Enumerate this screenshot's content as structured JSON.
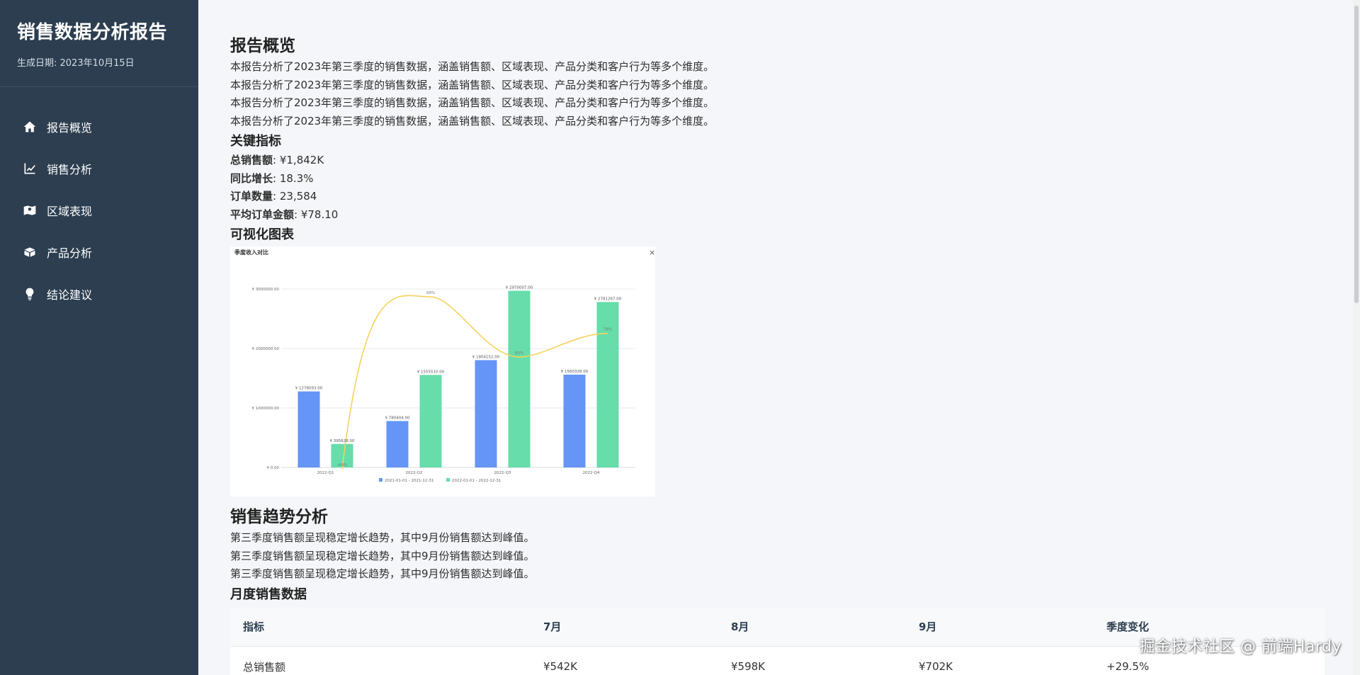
{
  "sidebar": {
    "title": "销售数据分析报告",
    "date": "生成日期: 2023年10月15日",
    "items": [
      {
        "label": "报告概览",
        "icon": "home-icon"
      },
      {
        "label": "销售分析",
        "icon": "line-chart-icon"
      },
      {
        "label": "区域表现",
        "icon": "map-icon"
      },
      {
        "label": "产品分析",
        "icon": "box-icon"
      },
      {
        "label": "结论建议",
        "icon": "lightbulb-icon"
      }
    ]
  },
  "overview": {
    "title": "报告概览",
    "paragraphs": [
      "本报告分析了2023年第三季度的销售数据，涵盖销售额、区域表现、产品分类和客户行为等多个维度。",
      "本报告分析了2023年第三季度的销售数据，涵盖销售额、区域表现、产品分类和客户行为等多个维度。",
      "本报告分析了2023年第三季度的销售数据，涵盖销售额、区域表现、产品分类和客户行为等多个维度。",
      "本报告分析了2023年第三季度的销售数据，涵盖销售额、区域表现、产品分类和客户行为等多个维度。"
    ],
    "metrics_title": "关键指标",
    "metrics": [
      {
        "label": "总销售额",
        "value": ": ¥1,842K"
      },
      {
        "label": "同比增长",
        "value": ": 18.3%"
      },
      {
        "label": "订单数量",
        "value": ": 23,584"
      },
      {
        "label": "平均订单金额",
        "value": ": ¥78.10"
      }
    ],
    "chart_title": "可视化图表"
  },
  "chart_data": {
    "type": "bar",
    "title": "季度收入对比",
    "close_glyph": "×",
    "categories": [
      "2022-Q1",
      "2022-Q2",
      "2022-Q3",
      "2022-Q4"
    ],
    "ylim": [
      0,
      3000000
    ],
    "yticks": [
      "¥ 0.00",
      "¥ 1000000.00",
      "¥ 2000000.00",
      "¥ 3000000.00"
    ],
    "series": [
      {
        "name": "2021-01-01 - 2021-12-31",
        "color": "#6595f7",
        "values": [
          1278093,
          780404,
          1804152,
          1560328
        ],
        "labels": [
          "¥ 1278093.00",
          "¥ 780404.00",
          "¥ 1804152.00",
          "¥ 1560328.00"
        ]
      },
      {
        "name": "2022-01-01 - 2022-12-31",
        "color": "#66ddaa",
        "values": [
          395628,
          1555510,
          2970007,
          2781267
        ],
        "labels": [
          "¥ 395628.00",
          "¥ 1555510.00",
          "¥ 2970007.00",
          "¥ 2781267.00"
        ]
      }
    ],
    "line": {
      "color": "#f7d25c",
      "labels": [
        "-69%",
        "99%",
        "65%",
        "78%"
      ]
    },
    "legend": "bottom",
    "grid": true
  },
  "trend": {
    "title": "销售趋势分析",
    "paragraphs": [
      "第三季度销售额呈现稳定增长趋势，其中9月份销售额达到峰值。",
      "第三季度销售额呈现稳定增长趋势，其中9月份销售额达到峰值。",
      "第三季度销售额呈现稳定增长趋势，其中9月份销售额达到峰值。"
    ],
    "table_title": "月度销售数据",
    "headers": [
      "指标",
      "7月",
      "8月",
      "9月",
      "季度变化"
    ],
    "rows": [
      [
        "总销售额",
        "¥542K",
        "¥598K",
        "¥702K",
        "+29.5%"
      ]
    ]
  },
  "watermark": "掘金技术社区 @ 前端Hardy"
}
